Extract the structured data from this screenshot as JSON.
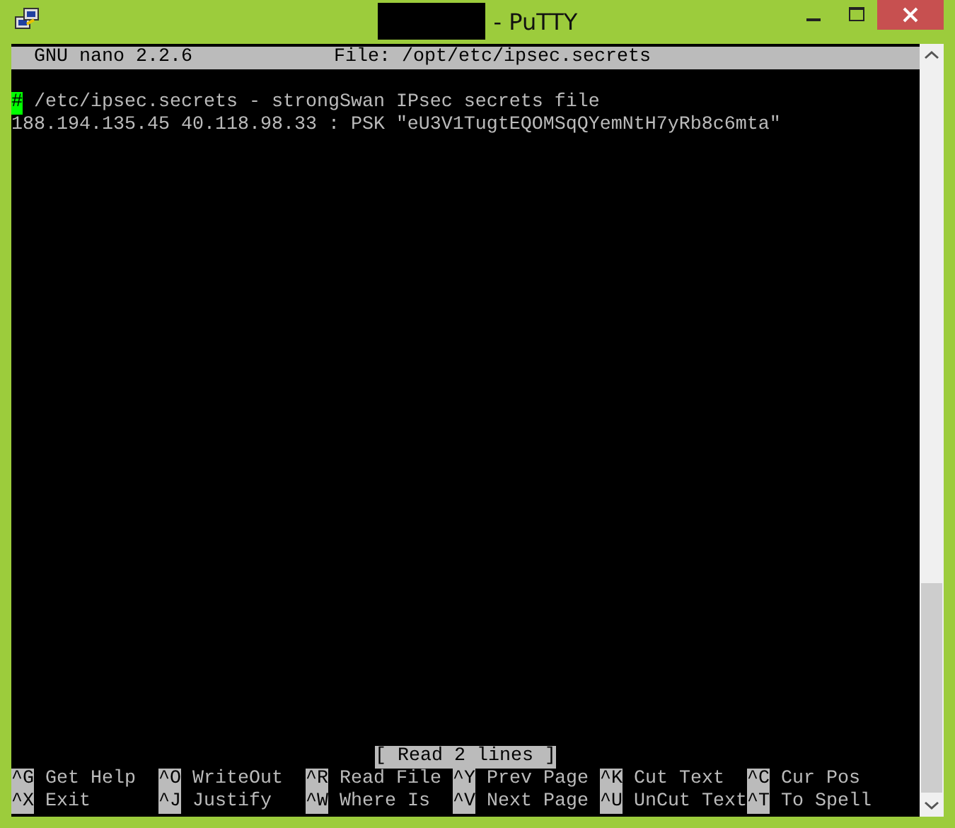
{
  "window": {
    "title": "- PuTTY",
    "title_redacted": true
  },
  "nano": {
    "version": "GNU nano 2.2.6",
    "file": "File: /opt/etc/ipsec.secrets"
  },
  "lines": [
    {
      "cursor": "#",
      "text": " /etc/ipsec.secrets - strongSwan IPsec secrets file"
    },
    {
      "text": "188.194.135.45 40.118.98.33 : PSK \"eU3V1TugtEQOMSqQYemNtH7yRb8c6mta\""
    }
  ],
  "status": "[ Read 2 lines ]",
  "shortcuts": [
    [
      {
        "key": "^G",
        "label": "Get Help"
      },
      {
        "key": "^O",
        "label": "WriteOut"
      },
      {
        "key": "^R",
        "label": "Read File"
      },
      {
        "key": "^Y",
        "label": "Prev Page"
      },
      {
        "key": "^K",
        "label": "Cut Text"
      },
      {
        "key": "^C",
        "label": "Cur Pos"
      }
    ],
    [
      {
        "key": "^X",
        "label": "Exit"
      },
      {
        "key": "^J",
        "label": "Justify"
      },
      {
        "key": "^W",
        "label": "Where Is"
      },
      {
        "key": "^V",
        "label": "Next Page"
      },
      {
        "key": "^U",
        "label": "UnCut Text"
      },
      {
        "key": "^T",
        "label": "To Spell"
      }
    ]
  ]
}
